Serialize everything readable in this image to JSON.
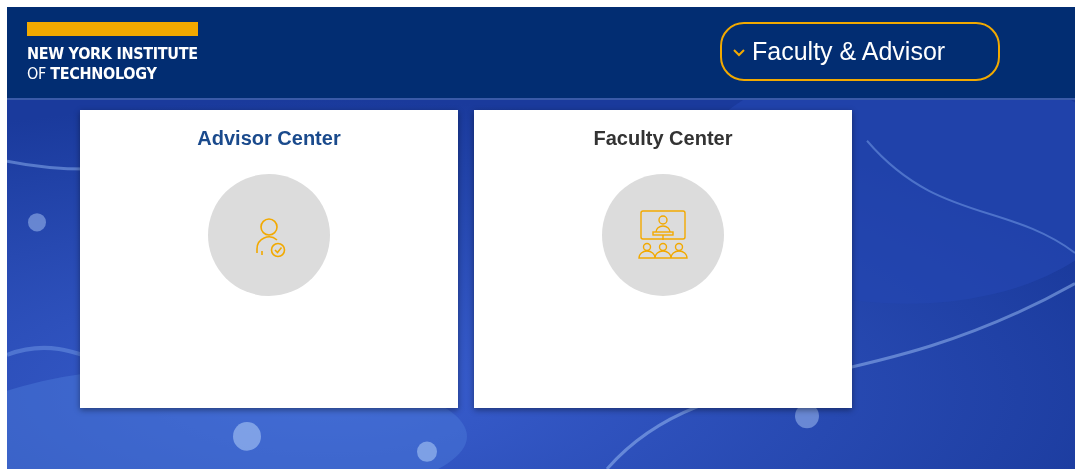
{
  "header": {
    "logo": {
      "line_1": "NEW YORK INSTITUTE",
      "line_2": "OF **TECHNOLOGY**"
    },
    "menu": {
      "label": "Faculty & Advisor",
      "expanded": false
    }
  },
  "tiles": [
    {
      "title": "Advisor Center",
      "selected": true,
      "kind": "advisor"
    },
    {
      "title": "Faculty Center",
      "selected": false,
      "kind": "faculty"
    }
  ]
}
